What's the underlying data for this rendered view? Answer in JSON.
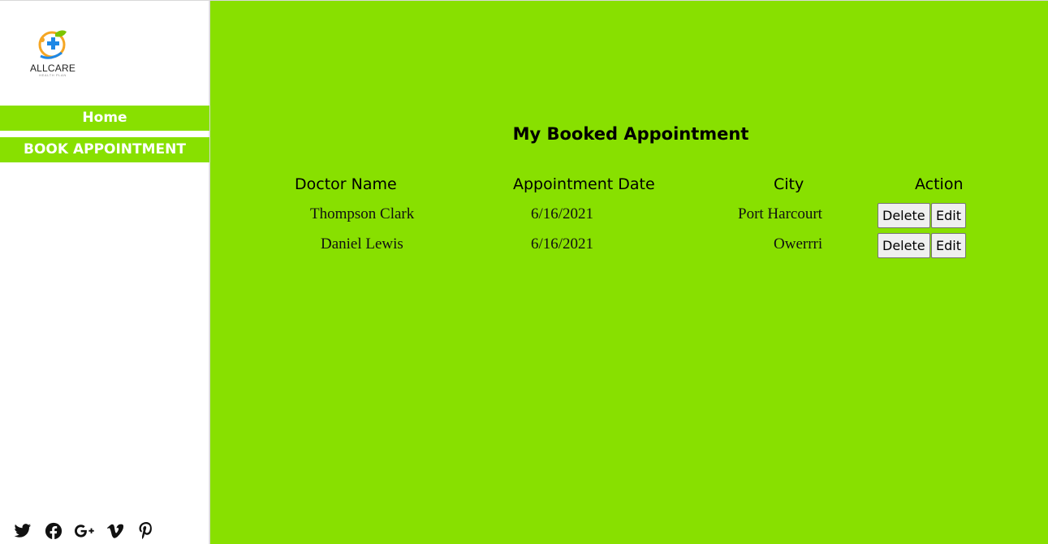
{
  "brand": {
    "name": "ALLCARE",
    "tagline": "HEALTH PLAN"
  },
  "nav": {
    "home_label": "Home",
    "book_label": "BOOK APPOINTMENT"
  },
  "social": [
    "twitter-icon",
    "facebook-icon",
    "google-plus-icon",
    "vimeo-icon",
    "pinterest-icon"
  ],
  "main": {
    "title": "My Booked Appointment",
    "columns": {
      "doctor": "Doctor Name",
      "date": "Appointment Date",
      "city": "City",
      "action": "Action"
    },
    "rows": [
      {
        "doctor": "Thompson Clark",
        "date": "6/16/2021",
        "city": "Port Harcourt",
        "delete_label": "Delete",
        "edit_label": "Edit"
      },
      {
        "doctor": "Daniel Lewis",
        "date": "6/16/2021",
        "city": "Owerrri",
        "delete_label": "Delete",
        "edit_label": "Edit"
      }
    ]
  },
  "colors": {
    "accent": "#88e000",
    "sidebar_bg": "#ffffff",
    "logo_blue": "#1e88e5",
    "logo_orange": "#f5a623",
    "logo_green": "#7cc400"
  }
}
